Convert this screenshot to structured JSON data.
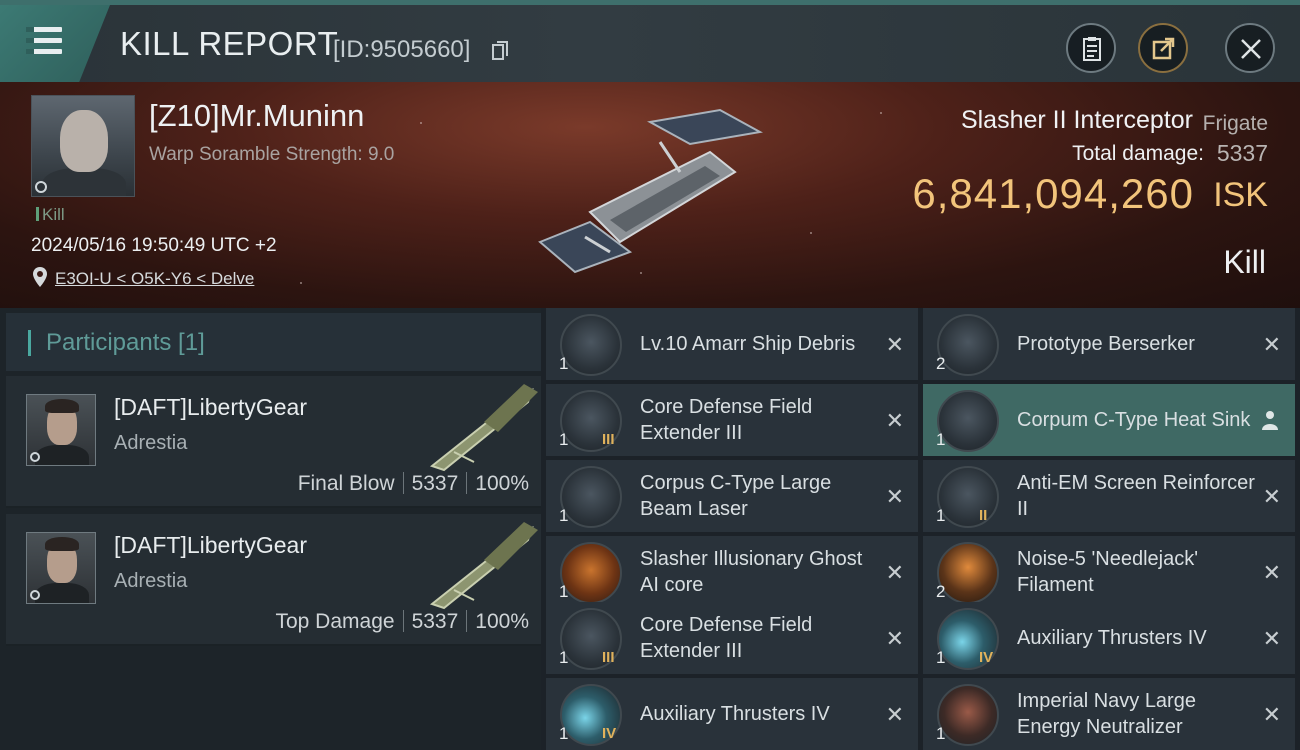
{
  "header": {
    "title": "KILL REPORT",
    "report_id": "[ID:9505660]"
  },
  "victim": {
    "name": "[Z10]Mr.Muninn",
    "warp_scramble": "Warp Soramble Strength: 9.0",
    "tag": "Kill",
    "datetime": "2024/05/16 19:50:49 UTC +2",
    "location": "E3OI-U < O5K-Y6 < Delve"
  },
  "ship": {
    "name": "Slasher II Interceptor",
    "class": "Frigate",
    "damage_label": "Total damage:",
    "damage_value": "5337",
    "isk_value": "6,841,094,260",
    "isk_unit": "ISK",
    "result": "Kill"
  },
  "participants": {
    "title": "Participants [1]",
    "list": [
      {
        "name": "[DAFT]LibertyGear",
        "corp": "Adrestia",
        "role": "Final Blow",
        "damage": "5337",
        "percent": "100%"
      },
      {
        "name": "[DAFT]LibertyGear",
        "corp": "Adrestia",
        "role": "Top Damage",
        "damage": "5337",
        "percent": "100%"
      }
    ]
  },
  "items": [
    {
      "name": "Lv.10 Amarr Ship Debris",
      "qty": "1",
      "tier": "",
      "icon": "debris-icon"
    },
    {
      "name": "Prototype  Berserker",
      "qty": "2",
      "tier": "",
      "icon": "drone-icon"
    },
    {
      "name": "Core Defense Field Extender III",
      "qty": "1",
      "tier": "III",
      "icon": "shield-extender-icon"
    },
    {
      "name": "Corpum C-Type Heat Sink",
      "qty": "1",
      "tier": "",
      "icon": "heat-sink-icon",
      "selected": true
    },
    {
      "name": "Corpus C-Type Large Beam Laser",
      "qty": "1",
      "tier": "",
      "icon": "beam-laser-icon"
    },
    {
      "name": "Anti-EM Screen Reinforcer II",
      "qty": "1",
      "tier": "II",
      "icon": "screen-reinforcer-icon"
    },
    {
      "name": "Slasher Illusionary Ghost AI core",
      "qty": "1",
      "tier": "",
      "icon": "ai-core-icon"
    },
    {
      "name": " Noise-5 'Needlejack' Filament",
      "qty": "2",
      "tier": "",
      "icon": "filament-icon"
    },
    {
      "name": "Core Defense Field Extender III",
      "qty": "1",
      "tier": "III",
      "icon": "shield-extender-icon"
    },
    {
      "name": "Auxiliary Thrusters IV",
      "qty": "1",
      "tier": "IV",
      "icon": "thruster-icon"
    },
    {
      "name": "Auxiliary Thrusters IV",
      "qty": "1",
      "tier": "IV",
      "icon": "thruster-icon"
    },
    {
      "name": "Imperial Navy Large Energy Neutralizer",
      "qty": "1",
      "tier": "",
      "icon": "energy-neutralizer-icon"
    }
  ],
  "colors": {
    "accent": "#3e6f6c",
    "isk": "#f2c47b",
    "selected_row": "#3f6964"
  }
}
